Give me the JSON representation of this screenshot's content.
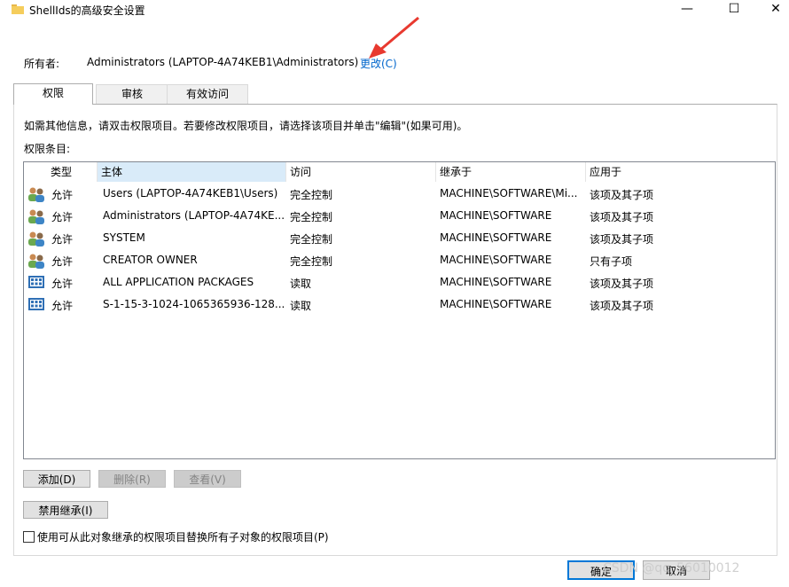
{
  "window": {
    "title": "ShellIds的高级安全设置",
    "minimize_glyph": "—",
    "maximize_glyph": "☐",
    "close_glyph": "✕"
  },
  "owner": {
    "label": "所有者:",
    "value": "Administrators (LAPTOP-4A74KEB1\\Administrators)",
    "change_link": "更改(C)"
  },
  "tabs": [
    {
      "label": "权限",
      "active": true
    },
    {
      "label": "审核",
      "active": false
    },
    {
      "label": "有效访问",
      "active": false
    }
  ],
  "info_text": "如需其他信息，请双击权限项目。若要修改权限项目，请选择该项目并单击\"编辑\"(如果可用)。",
  "entries_label": "权限条目:",
  "columns": [
    "类型",
    "主体",
    "访问",
    "继承于",
    "应用于"
  ],
  "rows": [
    {
      "icon": "users-icon",
      "type": "允许",
      "principal": "Users (LAPTOP-4A74KEB1\\Users)",
      "access": "完全控制",
      "inherited": "MACHINE\\SOFTWARE\\Mi...",
      "applies": "该项及其子项"
    },
    {
      "icon": "users-icon",
      "type": "允许",
      "principal": "Administrators (LAPTOP-4A74KE...",
      "access": "完全控制",
      "inherited": "MACHINE\\SOFTWARE",
      "applies": "该项及其子项"
    },
    {
      "icon": "users-icon",
      "type": "允许",
      "principal": "SYSTEM",
      "access": "完全控制",
      "inherited": "MACHINE\\SOFTWARE",
      "applies": "该项及其子项"
    },
    {
      "icon": "users-icon",
      "type": "允许",
      "principal": "CREATOR OWNER",
      "access": "完全控制",
      "inherited": "MACHINE\\SOFTWARE",
      "applies": "只有子项"
    },
    {
      "icon": "app-packages-icon",
      "type": "允许",
      "principal": "ALL APPLICATION PACKAGES",
      "access": "读取",
      "inherited": "MACHINE\\SOFTWARE",
      "applies": "该项及其子项"
    },
    {
      "icon": "app-packages-icon",
      "type": "允许",
      "principal": "S-1-15-3-1024-1065365936-128...",
      "access": "读取",
      "inherited": "MACHINE\\SOFTWARE",
      "applies": "该项及其子项"
    }
  ],
  "buttons": {
    "add": "添加(D)",
    "remove": "删除(R)",
    "view": "查看(V)",
    "disable_inheritance": "禁用继承(I)",
    "ok": "确定",
    "cancel": "取消"
  },
  "replace_checkbox": {
    "label": "使用可从此对象继承的权限项目替换所有子对象的权限项目(P)",
    "checked": false
  },
  "watermark": "CSDN @qq_56010012",
  "colors": {
    "link": "#0066cc",
    "arrow": "#e8392f",
    "header_sorted": "#d9ebf9",
    "default_button_border": "#0078d7"
  }
}
